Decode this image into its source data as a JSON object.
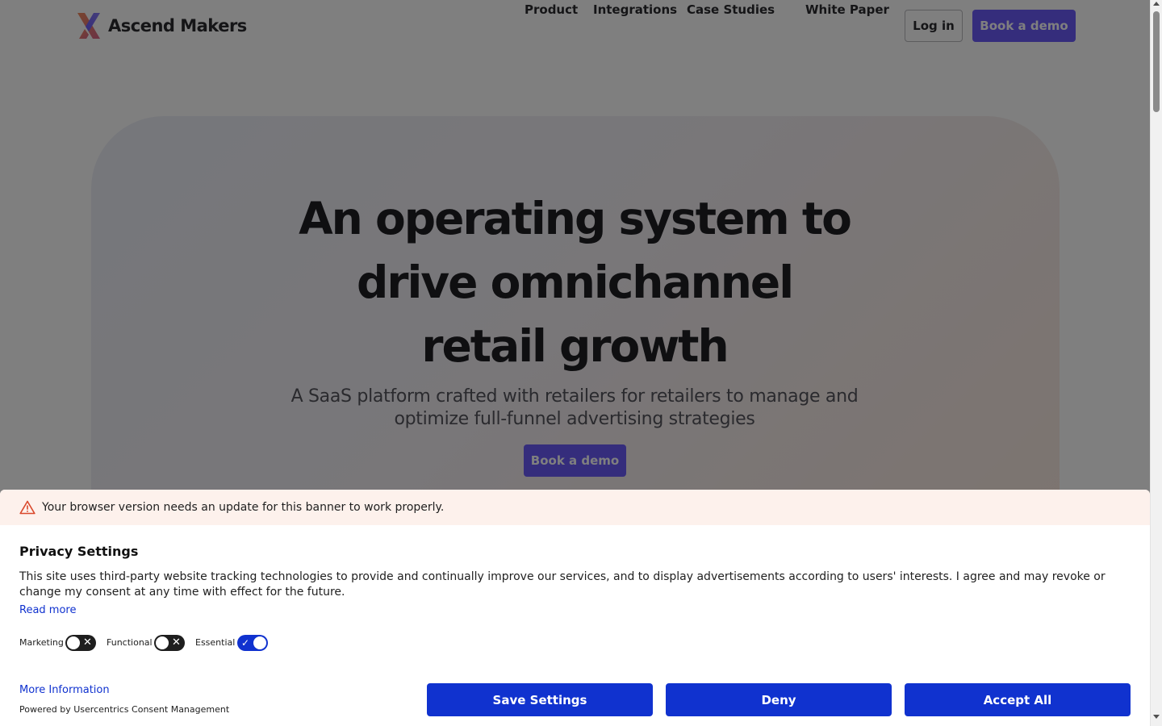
{
  "brand": {
    "name": "Ascend Makers",
    "accent": "#6a5af9"
  },
  "nav": {
    "items": [
      {
        "label": "Product"
      },
      {
        "label": "Integrations"
      },
      {
        "label": "Case Studies"
      },
      {
        "label": "White Paper"
      }
    ],
    "login_label": "Log in",
    "demo_label": "Book a demo"
  },
  "hero": {
    "title": "An operating system to drive omnichannel retail growth",
    "subtitle": "A SaaS platform crafted with retailers for retailers to manage and optimize full-funnel advertising strategies",
    "cta_label": "Book a demo"
  },
  "consent": {
    "warning": "Your browser version needs an update for this banner to work properly.",
    "title": "Privacy Settings",
    "description": "This site uses third-party website tracking technologies to provide and continually improve our services, and to display advertisements according to users' interests. I agree and may revoke or change my consent at any time with effect for the future.",
    "read_more": "Read more",
    "toggles": [
      {
        "label": "Marketing",
        "enabled": false
      },
      {
        "label": "Functional",
        "enabled": false
      },
      {
        "label": "Essential",
        "enabled": true
      }
    ],
    "more_info": "More Information",
    "powered_by": "Powered by Usercentrics Consent Management",
    "buttons": {
      "save": "Save Settings",
      "deny": "Deny",
      "accept": "Accept All"
    },
    "button_color": "#1032cf",
    "warning_bg": "#fdf1ec"
  },
  "icons": {
    "logo": "ascend-makers-x-logo",
    "warning": "warning-triangle-icon",
    "toggle_off": "close-icon",
    "toggle_on": "check-icon"
  }
}
